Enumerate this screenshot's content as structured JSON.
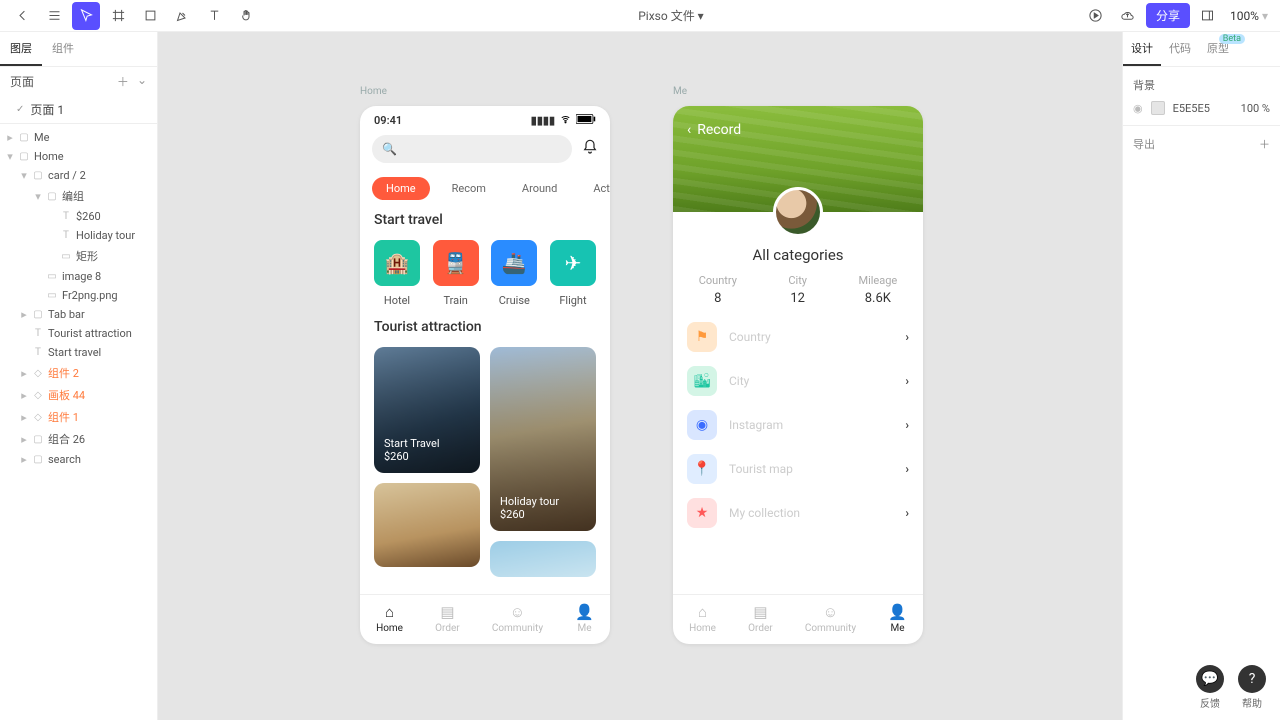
{
  "doc_title": "Pixso 文件 ▾",
  "share_label": "分享",
  "zoom": "100%",
  "left_tabs": [
    "图层",
    "组件"
  ],
  "pages_label": "页面",
  "page_items": [
    "页面 1"
  ],
  "layers": [
    {
      "d": 0,
      "tw": "▸",
      "ic": "▢",
      "label": "Me",
      "cls": ""
    },
    {
      "d": 0,
      "tw": "▾",
      "ic": "▢",
      "label": "Home",
      "cls": ""
    },
    {
      "d": 1,
      "tw": "▾",
      "ic": "▢",
      "label": "card / 2",
      "cls": ""
    },
    {
      "d": 2,
      "tw": "▾",
      "ic": "▢",
      "label": "编组",
      "cls": ""
    },
    {
      "d": 3,
      "tw": "",
      "ic": "T",
      "label": "$260",
      "cls": ""
    },
    {
      "d": 3,
      "tw": "",
      "ic": "T",
      "label": "Holiday tour",
      "cls": ""
    },
    {
      "d": 3,
      "tw": "",
      "ic": "▭",
      "label": "矩形",
      "cls": ""
    },
    {
      "d": 2,
      "tw": "",
      "ic": "▭",
      "label": "image 8",
      "cls": ""
    },
    {
      "d": 2,
      "tw": "",
      "ic": "▭",
      "label": "Fr2png.png",
      "cls": ""
    },
    {
      "d": 1,
      "tw": "▸",
      "ic": "▢",
      "label": "Tab bar",
      "cls": ""
    },
    {
      "d": 1,
      "tw": "",
      "ic": "T",
      "label": "Tourist attraction",
      "cls": ""
    },
    {
      "d": 1,
      "tw": "",
      "ic": "T",
      "label": "Start travel",
      "cls": ""
    },
    {
      "d": 1,
      "tw": "▸",
      "ic": "◇",
      "label": "组件 2",
      "cls": "orange"
    },
    {
      "d": 1,
      "tw": "▸",
      "ic": "◇",
      "label": "画板 44",
      "cls": "orange"
    },
    {
      "d": 1,
      "tw": "▸",
      "ic": "◇",
      "label": "组件 1",
      "cls": "orange"
    },
    {
      "d": 1,
      "tw": "▸",
      "ic": "▢",
      "label": "组合 26",
      "cls": ""
    },
    {
      "d": 1,
      "tw": "▸",
      "ic": "▢",
      "label": "search",
      "cls": ""
    }
  ],
  "right_tabs": [
    "设计",
    "代码",
    "原型"
  ],
  "right": {
    "bg_label": "背景",
    "hex": "E5E5E5",
    "opacity": "100 %",
    "export": "导出"
  },
  "floaters": {
    "feedback": "反馈",
    "help": "帮助"
  },
  "artboards": {
    "home": {
      "label": "Home",
      "time": "09:41",
      "tabs": [
        "Home",
        "Recom",
        "Around",
        "Activity"
      ],
      "start_travel": "Start travel",
      "cats": [
        {
          "label": "Hotel",
          "color": "#1ec6a1",
          "glyph": "🏨"
        },
        {
          "label": "Train",
          "color": "#ff5a3c",
          "glyph": "🚆"
        },
        {
          "label": "Cruise",
          "color": "#2a8cff",
          "glyph": "🚢"
        },
        {
          "label": "Flight",
          "color": "#17c3b2",
          "glyph": "✈"
        }
      ],
      "tourist": "Tourist attraction",
      "cards": [
        {
          "title": "Start Travel",
          "price": "$260"
        },
        {
          "title": "Holiday tour",
          "price": "$260"
        }
      ],
      "tabbar": [
        "Home",
        "Order",
        "Community",
        "Me"
      ]
    },
    "me": {
      "label": "Me",
      "back": "Record",
      "title": "All categories",
      "stats": [
        {
          "l": "Country",
          "v": "8"
        },
        {
          "l": "City",
          "v": "12"
        },
        {
          "l": "Mileage",
          "v": "8.6K"
        }
      ],
      "items": [
        {
          "label": "Country",
          "color": "#ffe7cc",
          "fg": "#ff9a3c",
          "glyph": "⚑"
        },
        {
          "label": "City",
          "color": "#d4f5e6",
          "fg": "#1ec6a1",
          "glyph": "🏙"
        },
        {
          "label": "Instagram",
          "color": "#d9e6ff",
          "fg": "#3a6cff",
          "glyph": "◉"
        },
        {
          "label": "Tourist map",
          "color": "#e0edff",
          "fg": "#3a8cff",
          "glyph": "📍"
        },
        {
          "label": "My collection",
          "color": "#ffe0e0",
          "fg": "#ff5a5a",
          "glyph": "★"
        }
      ],
      "tabbar": [
        "Home",
        "Order",
        "Community",
        "Me"
      ]
    }
  }
}
